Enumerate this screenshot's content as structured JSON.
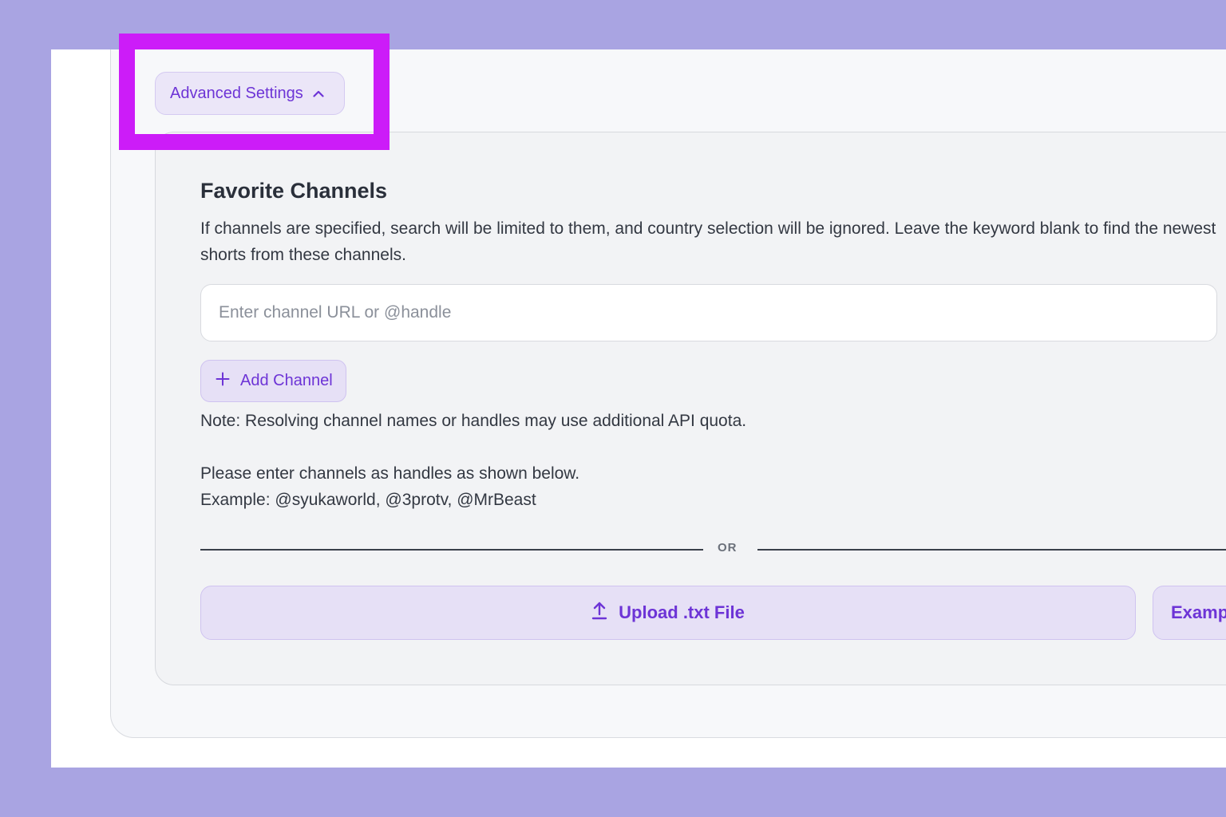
{
  "advanced_settings": {
    "label": "Advanced Settings",
    "icon": "chevron-up-icon"
  },
  "favorite_channels": {
    "title": "Favorite Channels",
    "description": "If channels are specified, search will be limited to them, and country selection will be ignored. Leave the keyword blank to find the newest shorts from these channels.",
    "input_placeholder": "Enter channel URL or @handle",
    "input_value": "",
    "add_button": {
      "label": "Add Channel",
      "icon": "plus-icon"
    },
    "note": "Note: Resolving channel names or handles may use additional API quota.",
    "hint_line_1": "Please enter channels as handles as shown below.",
    "hint_line_2": "Example: @syukaworld, @3protv, @MrBeast",
    "divider_label": "OR",
    "upload_button": {
      "label": "Upload .txt File",
      "icon": "upload-icon"
    },
    "example_button": {
      "label": "Examp"
    }
  },
  "colors": {
    "backdrop": "#a9a4e2",
    "accent": "#6d34d6",
    "button_bg": "#e6e0f6",
    "highlight": "#cc1cf8"
  }
}
